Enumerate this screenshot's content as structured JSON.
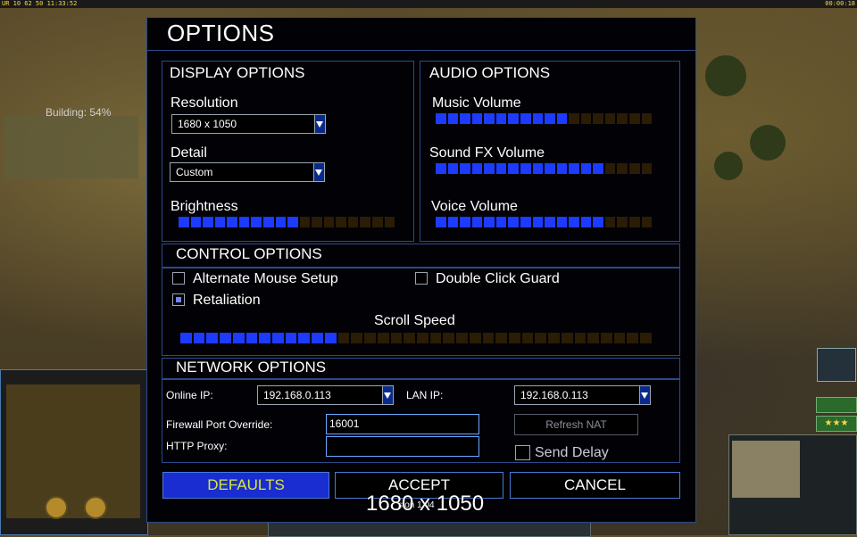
{
  "hud": {
    "top_left": "UR 10 62 50 11:33:52",
    "top_right": "00:00:18",
    "building_status": "Building: 54%"
  },
  "dialog": {
    "title": "OPTIONS",
    "display": {
      "header": "DISPLAY OPTIONS",
      "resolution_label": "Resolution",
      "resolution_value": "1680 x 1050",
      "detail_label": "Detail",
      "detail_value": "Custom",
      "brightness_label": "Brightness",
      "brightness_level": 0.55
    },
    "audio": {
      "header": "AUDIO OPTIONS",
      "music_label": "Music Volume",
      "music_level": 0.6,
      "sfx_label": "Sound FX Volume",
      "sfx_level": 0.75,
      "voice_label": "Voice Volume",
      "voice_level": 0.8
    },
    "control": {
      "header": "CONTROL OPTIONS",
      "alternate_mouse_label": "Alternate Mouse Setup",
      "alternate_mouse_checked": false,
      "double_click_label": "Double Click Guard",
      "double_click_checked": false,
      "retaliation_label": "Retaliation",
      "retaliation_checked": true,
      "scroll_label": "Scroll Speed",
      "scroll_level": 0.33
    },
    "network": {
      "header": "NETWORK OPTIONS",
      "online_ip_label": "Online IP:",
      "online_ip_value": "192.168.0.113",
      "lan_ip_label": "LAN IP:",
      "lan_ip_value": "192.168.0.113",
      "firewall_label": "Firewall Port Override:",
      "firewall_value": "16001",
      "proxy_label": "HTTP Proxy:",
      "proxy_value": "",
      "refresh_nat_label": "Refresh NAT",
      "send_delay_label": "Send Delay",
      "send_delay_checked": false
    },
    "buttons": {
      "defaults": "DEFAULTS",
      "accept": "ACCEPT",
      "cancel": "CANCEL"
    }
  },
  "overlay": {
    "resolution_tooltip": "1680 x 1050",
    "clipped_text": "sion 1.04"
  },
  "colors": {
    "frame_border": "#2b4a8a",
    "bar_on": "#1d3bff",
    "bar_off": "#2a1c05",
    "primary_button": "#1a2dd0",
    "primary_text": "#d8e83a"
  }
}
